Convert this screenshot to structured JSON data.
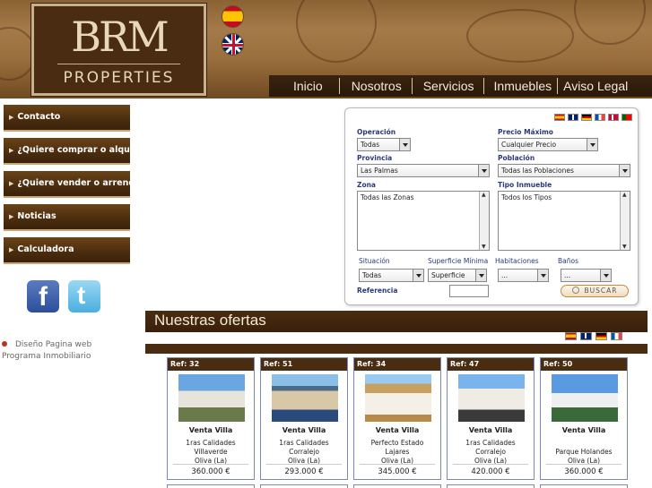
{
  "logo": {
    "mark": "BRM",
    "subtitle": "PROPERTIES"
  },
  "nav": [
    "Inicio",
    "Nosotros",
    "Servicios",
    "Inmuebles",
    "Aviso Legal"
  ],
  "sidebar": {
    "items": [
      {
        "label": "Contacto"
      },
      {
        "label": "¿Quiere comprar o alquilar?"
      },
      {
        "label": "¿Quiere vender o arrendar?"
      },
      {
        "label": "Noticias"
      },
      {
        "label": "Calculadora"
      }
    ],
    "credit_line1": "Diseño Pagina web",
    "credit_line2": "Programa Inmobiliario"
  },
  "search": {
    "operacion_label": "Operación",
    "operacion_value": "Todas",
    "precio_label": "Precio Máximo",
    "precio_value": "Cualquier Precio",
    "provincia_label": "Provincia",
    "provincia_value": "Las Palmas",
    "poblacion_label": "Población",
    "poblacion_value": "Todas las Poblaciones",
    "zona_label": "Zona",
    "zona_value": "Todas las Zonas",
    "tipo_label": "Tipo Inmueble",
    "tipo_value": "Todos los Tipos",
    "situacion_label": "Situación",
    "situacion_value": "Todas",
    "superficie_label": "Superficie Mínima",
    "superficie_value": "Superficie",
    "habitaciones_label": "Habitaciones",
    "habitaciones_value": "...",
    "banos_label": "Baños",
    "banos_value": "...",
    "referencia_label": "Referencia",
    "buscar_label": "BUSCAR"
  },
  "offers": {
    "title": "Nuestras ofertas",
    "cards": [
      {
        "ref": "Ref: 32",
        "type": "Venta Villa",
        "line1": "1ras Calidades",
        "line2": "Villaverde",
        "line3": "Oliva (La)",
        "price": "360.000 €"
      },
      {
        "ref": "Ref: 51",
        "type": "Venta Villa",
        "line1": "1ras Calidades",
        "line2": "Corralejo",
        "line3": "Oliva (La)",
        "price": "293.000 €"
      },
      {
        "ref": "Ref: 34",
        "type": "Venta Villa",
        "line1": "Perfecto Estado",
        "line2": "Lajares",
        "line3": "Oliva (La)",
        "price": "345.000 €"
      },
      {
        "ref": "Ref: 47",
        "type": "Venta Villa",
        "line1": "1ras Calidades",
        "line2": "Corralejo",
        "line3": "Oliva (La)",
        "price": "420.000 €"
      },
      {
        "ref": "Ref: 50",
        "type": "Venta Villa",
        "line1": "",
        "line2": "Parque Holandes",
        "line3": "Oliva (La)",
        "price": "360.000 €"
      }
    ]
  },
  "colors": {
    "brand_brown": "#4a2c10",
    "label_blue": "#2a3a7a",
    "card_border": "#7a8ab8"
  }
}
